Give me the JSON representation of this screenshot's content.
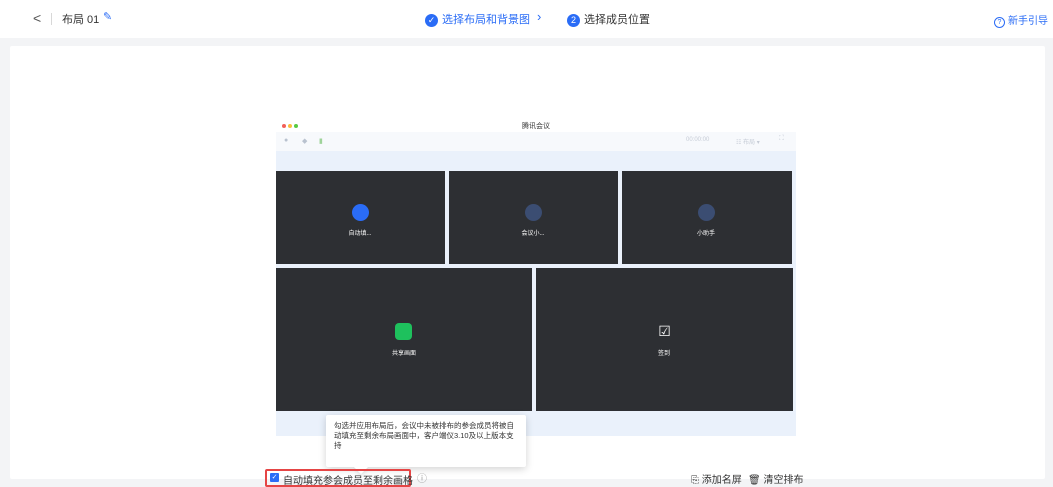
{
  "header": {
    "title": "布局 01",
    "steps": [
      {
        "num": "✓",
        "label": "选择布局和背景图"
      },
      {
        "num": "2",
        "label": "选择成员位置"
      }
    ],
    "guide_label": "新手引导"
  },
  "preview": {
    "window_title": "腾讯会议",
    "timer": "00:00:00",
    "layout_label": "布局",
    "tiles": [
      {
        "label": "自动填..."
      },
      {
        "label": "会议小..."
      },
      {
        "label": "小助手"
      },
      {
        "label": "共享画面"
      },
      {
        "label": "签到"
      }
    ]
  },
  "tooltip": {
    "text": "勾选并应用布局后，会议中未被排布的参会成员将被自动填充至剩余布局画面中，客户端仪3.10及以上版本支持"
  },
  "bottom": {
    "checkbox_label": "自动填充参会成员至剩余画格",
    "add_label": "添加名屏",
    "clear_label": "清空排布"
  },
  "colors": {
    "accent": "#2a6cf6",
    "tile_bg": "#2d2f33",
    "highlight_border": "#e54545"
  }
}
